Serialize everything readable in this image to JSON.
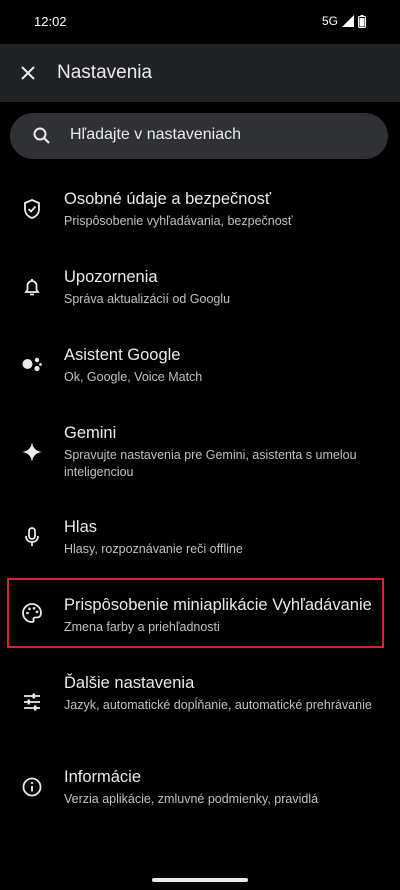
{
  "status": {
    "time": "12:02",
    "network": "5G"
  },
  "app_bar": {
    "title": "Nastavenia"
  },
  "search": {
    "placeholder": "Hľadajte v nastaveniach"
  },
  "settings": [
    {
      "icon": "shield-icon",
      "title": "Osobné údaje a bezpečnosť",
      "subtitle": "Prispôsobenie vyhľadávania, bezpečnosť"
    },
    {
      "icon": "bell-icon",
      "title": "Upozornenia",
      "subtitle": "Správa aktualizácií od Googlu"
    },
    {
      "icon": "assistant-icon",
      "title": "Asistent Google",
      "subtitle": "Ok, Google, Voice Match"
    },
    {
      "icon": "sparkle-icon",
      "title": "Gemini",
      "subtitle": "Spravujte nastavenia pre Gemini, asistenta s umelou inteligenciou"
    },
    {
      "icon": "microphone-icon",
      "title": "Hlas",
      "subtitle": "Hlasy, rozpoznávanie reči offline"
    },
    {
      "icon": "palette-icon",
      "title": "Prispôsobenie miniaplikácie Vyhľadávanie",
      "subtitle": "Zmena farby a priehľadnosti"
    },
    {
      "icon": "sliders-icon",
      "title": "Ďalšie nastavenia",
      "subtitle": "Jazyk, automatické dopĺňanie, automatické prehrávanie"
    },
    {
      "icon": "info-icon",
      "title": "Informácie",
      "subtitle": "Verzia aplikácie, zmluvné podmienky, pravidlá"
    }
  ],
  "colors": {
    "background": "#000000",
    "app_bar": "#202124",
    "search_bar": "#303134",
    "highlight_border": "#d9232f"
  }
}
